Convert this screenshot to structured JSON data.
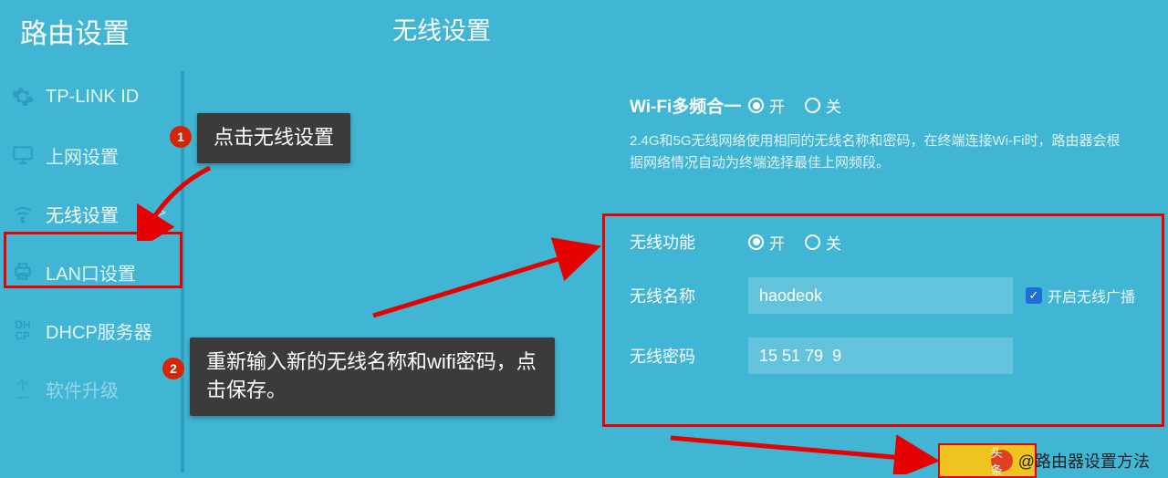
{
  "sidebar": {
    "title": "路由设置",
    "items": [
      {
        "label": "TP-LINK ID",
        "icon": "gear"
      },
      {
        "label": "上网设置",
        "icon": "monitor"
      },
      {
        "label": "无线设置",
        "icon": "wifi",
        "chev": ">"
      },
      {
        "label": "LAN口设置",
        "icon": "printer"
      },
      {
        "label": "DHCP服务器",
        "icon": "dhcp"
      },
      {
        "label": "软件升级",
        "icon": "upgrade"
      }
    ]
  },
  "main": {
    "title": "无线设置",
    "multiband": {
      "label": "Wi-Fi多频合一",
      "on": "开",
      "off": "关",
      "hint": "2.4G和5G无线网络使用相同的无线名称和密码，在终端连接Wi-Fi时，路由器会根据网络情况自动为终端选择最佳上网频段。"
    },
    "form": {
      "func_label": "无线功能",
      "on": "开",
      "off": "关",
      "name_label": "无线名称",
      "name_value": "haodeok",
      "broadcast": "开启无线广播",
      "pwd_label": "无线密码",
      "pwd_value": "15 51 79  9"
    }
  },
  "annotations": {
    "step1_num": "1",
    "step1_text": "点击无线设置",
    "step2_num": "2",
    "step2_text": "重新输入新的无线名称和wifi密码，点击保存。"
  },
  "watermark": {
    "prefix": "头条",
    "attr": "@路由器设置方法"
  }
}
